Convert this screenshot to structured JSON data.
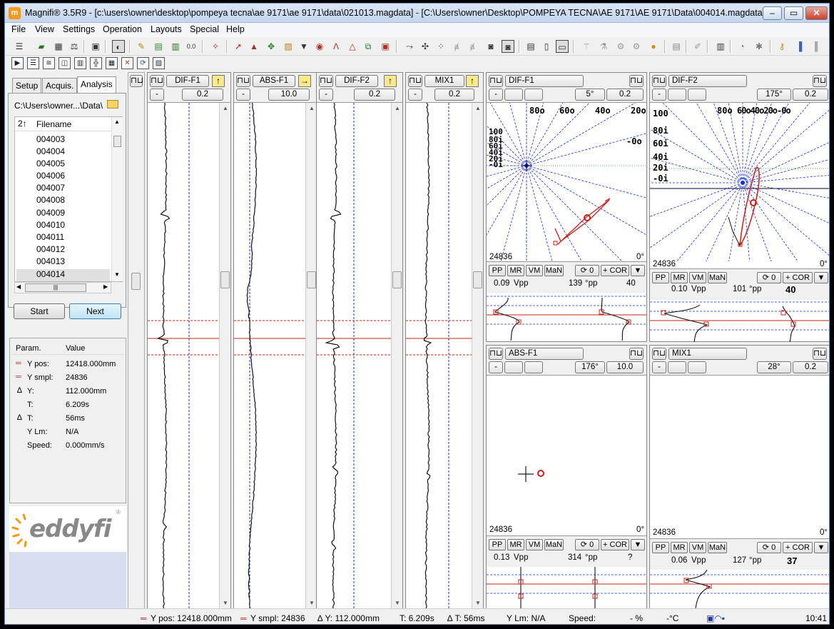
{
  "window": {
    "app_icon": "m",
    "title": "Magnifi® 3.5R9 - [c:\\users\\owner\\desktop\\pompeya tecna\\ae 9171\\ae 9171\\data\\021013.magdata] - [C:\\Users\\owner\\Desktop\\POMPEYA TECNA\\AE 9171\\AE 9171\\Data\\004014.magdata]",
    "min": "–",
    "max": "▭",
    "close": "✕"
  },
  "menu": [
    "File",
    "View",
    "Settings",
    "Operation",
    "Layouts",
    "Special",
    "Help"
  ],
  "toolbar_icons": [
    "list-icon",
    "device-icon",
    "rack-icon",
    "balance-icon",
    "save-icon",
    "lens-icon",
    "pen-icon",
    "calc-icon",
    "chart-icon",
    "zero-icon",
    "wand-icon",
    "probe-icon",
    "boat-icon",
    "target-icon",
    "doc-icon",
    "filter-icon",
    "eye-icon",
    "angle-icon",
    "triangle-icon",
    "copy-icon",
    "picture-icon",
    "arrow-icon",
    "move-icon",
    "scatter-icon",
    "a1-icon",
    "a2-icon",
    "camera-icon",
    "cameras-icon",
    "page-icon",
    "page2-icon",
    "ruler-icon",
    "trim-icon",
    "flask-icon",
    "fab1-icon",
    "fab2-icon",
    "bulb-icon",
    "list2-icon",
    "pen2-icon",
    "phone-icon",
    "drum-icon",
    "gear-icon",
    "key-icon",
    "chart2-icon",
    "chart3-icon"
  ],
  "layout_icons": [
    "play-layout",
    "horizontal-layout",
    "wave-layout",
    "split-layout",
    "grid-layout",
    "cross-layout",
    "table-layout",
    "close-layout",
    "refresh-layout",
    "stripe-layout"
  ],
  "left_panel": {
    "tabs": [
      "Setup",
      "Acquis.",
      "Analysis"
    ],
    "path": "C:\\Users\\owner...\\Data\\",
    "filelist_header": "Filename",
    "sort_icon": "2↑",
    "files": [
      "004003",
      "004004",
      "004005",
      "004006",
      "004007",
      "004008",
      "004009",
      "004010",
      "004011",
      "004012",
      "004013",
      "004014"
    ],
    "start_label": "Start",
    "next_label": "Next",
    "params_header": [
      "Param.",
      "Value"
    ],
    "params": [
      {
        "icon": "═",
        "name": "Y pos:",
        "value": "12418.000mm"
      },
      {
        "icon": "═",
        "name": "Y smpl:",
        "value": "24836"
      },
      {
        "icon": "∆",
        "name": "Y:",
        "value": "112.000mm"
      },
      {
        "icon": "",
        "name": "T:",
        "value": "6.209s"
      },
      {
        "icon": "∆",
        "name": "T:",
        "value": "56ms"
      },
      {
        "icon": "",
        "name": "Y Lm:",
        "value": "N/A"
      },
      {
        "icon": "",
        "name": "Speed:",
        "value": "0.000mm/s"
      }
    ],
    "logo": "eddyfi",
    "logo_mark": "®"
  },
  "strips": [
    {
      "name": "DIF-F1",
      "arrow": "↑",
      "minus": "-",
      "value": "0.2"
    },
    {
      "name": "ABS-F1",
      "arrow": "→",
      "minus": "-",
      "value": "10.0"
    },
    {
      "name": "DIF-F2",
      "arrow": "↑",
      "minus": "-",
      "value": "0.2"
    },
    {
      "name": "MIX1",
      "arrow": "↑",
      "minus": "-",
      "value": "0.2"
    }
  ],
  "strip_common": {
    "mode_icon": "⊓⊔"
  },
  "vectors": [
    {
      "name": "DIF-F1",
      "minus": "-",
      "angle": "5°",
      "gain": "0.2",
      "sample": "24836",
      "deg": "0°",
      "labels_top": [
        "80o",
        "60o",
        "40o",
        "20o"
      ],
      "labels_left": [
        "100",
        "80i",
        "60i",
        "40i",
        "20i",
        "-0i"
      ],
      "label_right": "-0o",
      "btns": [
        "PP",
        "MR",
        "VM",
        "MaN"
      ],
      "rot": "⟳ 0",
      "cor": "+ COR",
      "drop": "▼",
      "vpp": "0.09",
      "vpp_unit": "Vpp",
      "deg_val": "139",
      "deg_unit": "°pp",
      "extra": "40"
    },
    {
      "name": "DIF-F2",
      "minus": "-",
      "angle": "175°",
      "gain": "0.2",
      "sample": "24836",
      "deg": "0°",
      "labels_top": [
        "80o",
        "60o40o20o-0o"
      ],
      "labels_left": [
        "100",
        "80i",
        "60i",
        "40i",
        "20i",
        "-0i"
      ],
      "label_right": "",
      "btns": [
        "PP",
        "MR",
        "VM",
        "MaN"
      ],
      "rot": "⟳ 0",
      "cor": "+ COR",
      "drop": "▼",
      "vpp": "0.10",
      "vpp_unit": "Vpp",
      "deg_val": "101",
      "deg_unit": "°pp",
      "extra": "40"
    },
    {
      "name": "ABS-F1",
      "minus": "-",
      "angle": "176°",
      "gain": "10.0",
      "sample": "24836",
      "deg": "0°",
      "btns": [
        "PP",
        "MR",
        "VM",
        "MaN"
      ],
      "rot": "⟳ 0",
      "cor": "+ COR",
      "drop": "▼",
      "vpp": "0.13",
      "vpp_unit": "Vpp",
      "deg_val": "314",
      "deg_unit": "°pp",
      "extra": "?"
    },
    {
      "name": "MIX1",
      "minus": "-",
      "angle": "28°",
      "gain": "0.2",
      "sample": "24836",
      "deg": "0°",
      "btns": [
        "PP",
        "MR",
        "VM",
        "MaN"
      ],
      "rot": "⟳ 0",
      "cor": "+ COR",
      "drop": "▼",
      "vpp": "0.06",
      "vpp_unit": "Vpp",
      "deg_val": "127",
      "deg_unit": "°pp",
      "extra": "37"
    }
  ],
  "status": {
    "ypos": "Y pos: 12418.000mm",
    "ysmpl": "Y smpl: 24836",
    "dy": "∆ Y: 112.000mm",
    "t": "T: 6.209s",
    "dt": "∆ T: 56ms",
    "ylm": "Y Lm: N/A",
    "speed": "Speed:",
    "pct": "- %",
    "temp": "-°C",
    "time": "10:41"
  },
  "colors": {
    "accent": "#3c7fb1",
    "trace_red": "#c8201a",
    "grid_blue": "#1a2fd0",
    "logo_orange": "#f39a1e"
  }
}
